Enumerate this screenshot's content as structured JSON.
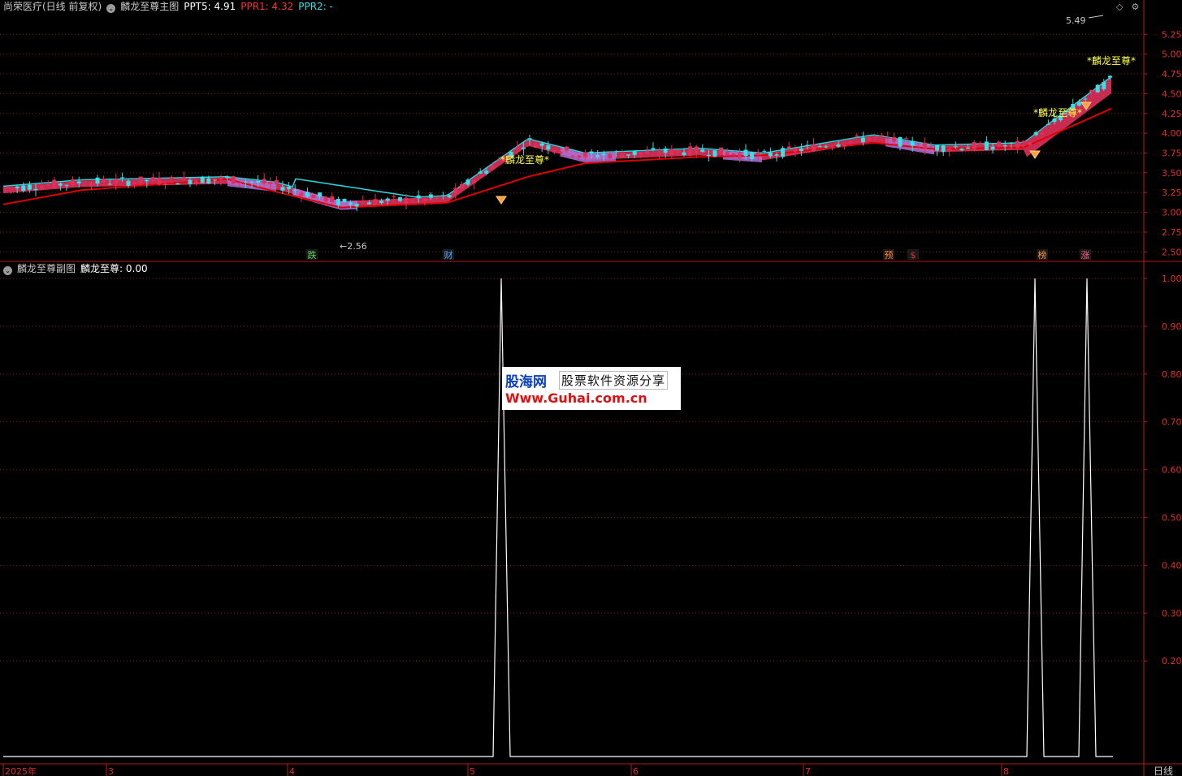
{
  "main_header": {
    "stock": "尚荣医疗(日线 前复权)",
    "indicator": "麟龙至尊主图",
    "ppt5_label": "PPT5: 4.91",
    "ppr1_label": "PPR1: 4.32",
    "ppr2_label": "PPR2: -"
  },
  "sub_header": {
    "indicator": "麟龙至尊副图",
    "value_label": "麟龙至尊: 0.00"
  },
  "top_right_icons": [
    "diamond-icon",
    "settings-icon"
  ],
  "colors": {
    "background": "#000000",
    "up": "#e0305a",
    "down": "#36e0e8",
    "ma_red": "#e00000",
    "ma_cyan": "#28d8e0",
    "band_pink": "#e0305a",
    "band_purple": "#b070d8",
    "grid": "#8b1a1a",
    "axis": "#c01818",
    "signal": "#ffffff",
    "label": "#ffff40"
  },
  "main_chart": {
    "ylim": [
      2.4,
      5.5
    ],
    "yticks": [
      "5.25",
      "5.00",
      "4.75",
      "4.50",
      "4.25",
      "4.00",
      "3.75",
      "3.50",
      "3.25",
      "3.00",
      "2.75",
      "2.50"
    ],
    "high_label": "5.49",
    "low_label": "2.56",
    "event_markers": [
      {
        "label": "跌",
        "x": 384,
        "color": "#60d060"
      },
      {
        "label": "财",
        "x": 552,
        "color": "#50a0ff"
      },
      {
        "label": "预",
        "x": 1094,
        "color": "#ff8030"
      },
      {
        "label": "$",
        "x": 1124,
        "color": "#e03030"
      },
      {
        "label": "榜",
        "x": 1283,
        "color": "#ff9040"
      },
      {
        "label": "涨",
        "x": 1336,
        "color": "#ff6080"
      }
    ],
    "signal_labels": [
      {
        "text": "*麟龙至尊*",
        "x": 616,
        "y": 201
      },
      {
        "text": "*麟龙至尊*",
        "x": 1272,
        "y": 143
      },
      {
        "text": "*麟龙至尊*",
        "x": 1338,
        "y": 79
      }
    ]
  },
  "sub_chart": {
    "ylim": [
      0,
      1.05
    ],
    "yticks": [
      "1.00",
      "0.90",
      "0.80",
      "0.70",
      "0.60",
      "0.50",
      "0.40",
      "0.30",
      "0.20"
    ]
  },
  "xaxis": {
    "labels": [
      {
        "text": "2025年",
        "x": 4
      },
      {
        "text": "3",
        "x": 131
      },
      {
        "text": "4",
        "x": 354
      },
      {
        "text": "5",
        "x": 576
      },
      {
        "text": "6",
        "x": 777
      },
      {
        "text": "7",
        "x": 989
      },
      {
        "text": "8",
        "x": 1233
      }
    ],
    "period": "日线"
  },
  "watermark": {
    "brand": "股海网",
    "subtitle": "股票软件资源分享",
    "url": "Www.Guhai.com.cn"
  },
  "chart_data": [
    {
      "type": "candlestick",
      "title": "麟龙至尊主图",
      "ylim": [
        2.4,
        5.5
      ],
      "x": [
        "2025-02",
        "2025-03",
        "2025-04",
        "2025-05",
        "2025-06",
        "2025-07",
        "2025-08"
      ],
      "annotations": {
        "high": 5.49,
        "low": 2.56
      },
      "series": [
        {
          "name": "PPT5",
          "values": [
            3.3,
            3.38,
            3.42,
            3.35,
            3.12,
            3.18,
            3.9,
            3.72,
            3.78,
            3.72,
            3.95,
            3.82,
            3.85,
            4.7
          ]
        },
        {
          "name": "PPR1",
          "values": [
            3.1,
            3.28,
            3.42,
            3.26,
            3.06,
            3.12,
            3.45,
            3.62,
            3.7,
            3.72,
            3.88,
            3.8,
            3.82,
            4.32
          ]
        }
      ]
    },
    {
      "type": "line",
      "title": "麟龙至尊副图",
      "ylim": [
        0,
        1.05
      ],
      "series": [
        {
          "name": "麟龙至尊",
          "values": [
            0,
            0,
            0,
            0,
            1,
            0,
            0,
            0,
            0,
            0,
            0,
            1,
            0,
            1,
            0
          ]
        }
      ]
    }
  ]
}
